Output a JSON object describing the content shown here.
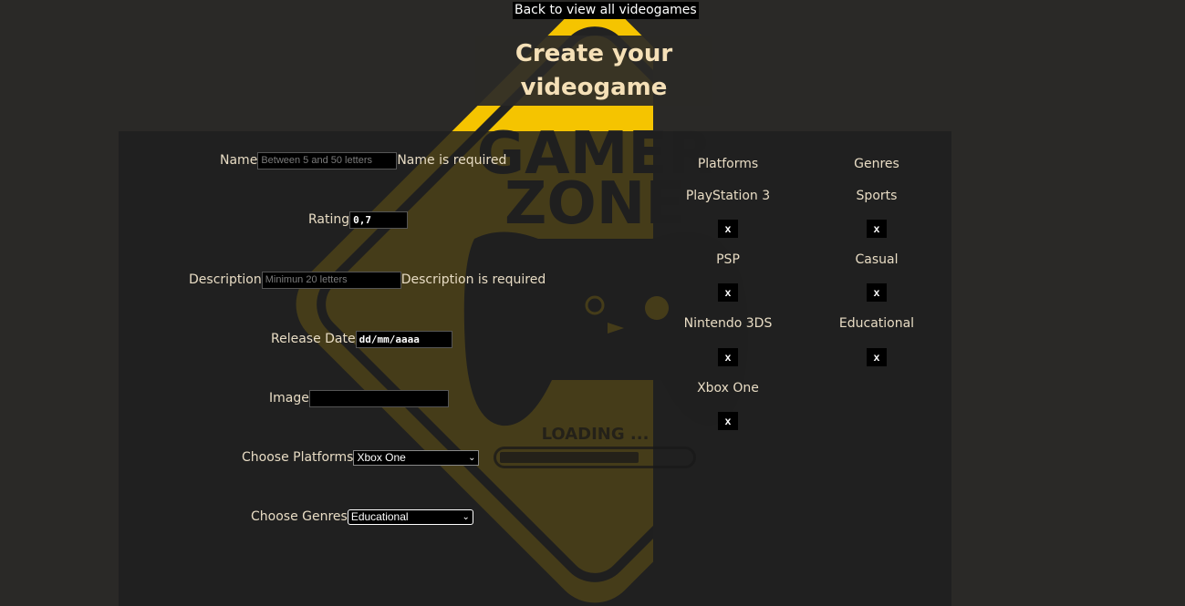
{
  "header": {
    "back_link": "Back to view all videogames",
    "title": "Create your videogame"
  },
  "background": {
    "logo_line1": "GAMER",
    "logo_line2": "ZONE",
    "accent_color": "#f5c400"
  },
  "form": {
    "name": {
      "label": "Name",
      "placeholder": "Between 5 and 50 letters",
      "error": "Name is required"
    },
    "rating": {
      "label": "Rating",
      "value": "0,7"
    },
    "description": {
      "label": "Description",
      "placeholder": "Minimun 20 letters",
      "error": "Description is required"
    },
    "release_date": {
      "label": "Release Date",
      "placeholder": "dd/mm/aaaa"
    },
    "image": {
      "label": "Image",
      "value": ""
    },
    "platforms": {
      "label": "Choose Platforms",
      "selected": "Xbox One"
    },
    "genres": {
      "label": "Choose Genres",
      "selected": "Educational"
    }
  },
  "platforms_list": {
    "title": "Platforms",
    "items": [
      "PlayStation 3",
      "PSP",
      "Nintendo 3DS",
      "Xbox One"
    ],
    "remove_label": "x"
  },
  "genres_list": {
    "title": "Genres",
    "items": [
      "Sports",
      "Casual",
      "Educational"
    ],
    "remove_label": "x"
  },
  "loading": {
    "text": "LOADING ...",
    "progress": 0.73
  }
}
